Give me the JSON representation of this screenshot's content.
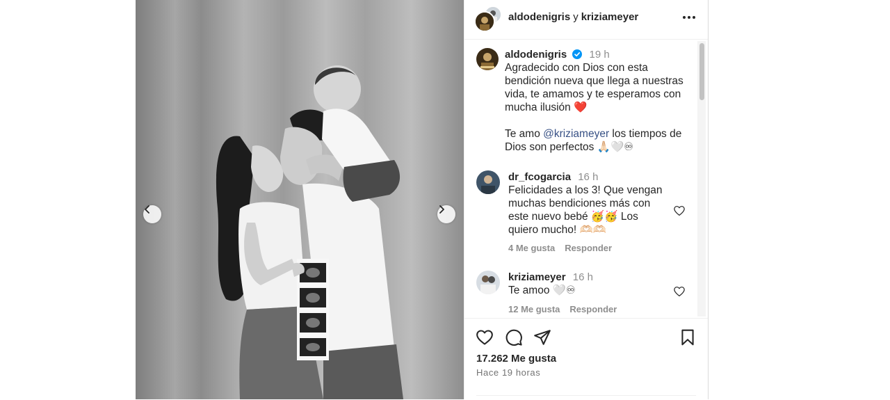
{
  "post": {
    "photo_alt": "",
    "nav": {
      "prev_icon": "chevron-left-icon",
      "next_icon": "chevron-right-icon"
    }
  },
  "header": {
    "user1": "aldodenigris",
    "conjunction": "y",
    "user2": "kriziameyer",
    "more_icon": "more-horizontal-icon"
  },
  "caption": {
    "username": "aldodenigris",
    "time": "19 h",
    "text_part1": "Agradecido con Dios con esta bendición nueva que llega a nuestras vida, te amamos y te esperamos con mucha ilusión ❤️\n\nTe amo ",
    "mention": "@kriziameyer",
    "text_part2": " los tiempos de Dios son perfectos 🙏🏻🤍♾"
  },
  "comments": [
    {
      "username": "dr_fcogarcia",
      "time": "16 h",
      "text": "Felicidades a los 3! Que vengan muchas bendiciones más con este nuevo bebé 🥳🥳 Los quiero mucho! 🫶🏻🫶🏻",
      "likes": "4 Me gusta",
      "reply": "Responder"
    },
    {
      "username": "kriziameyer",
      "time": "16 h",
      "text": "Te amoo 🤍♾",
      "likes": "12 Me gusta",
      "reply": "Responder"
    }
  ],
  "actions": {
    "like_count": "17.262 Me gusta",
    "posted": "Hace 19 horas"
  },
  "colors": {
    "text": "#262626",
    "secondary": "#8e8e8e",
    "mention": "#385185",
    "verified": "#0095f6",
    "heart": "#ed4956"
  }
}
